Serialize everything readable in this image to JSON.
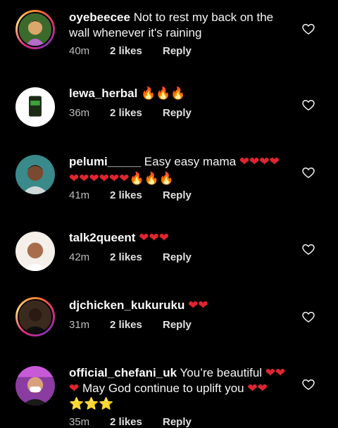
{
  "comments": [
    {
      "username": "oyebeecee",
      "text": "Not to rest my back on the wall whenever it's raining",
      "emoji": "",
      "time": "40m",
      "likes": "2 likes",
      "reply": "Reply"
    },
    {
      "username": "lewa_herbal",
      "text": "",
      "emoji": "🔥🔥🔥",
      "time": "36m",
      "likes": "2 likes",
      "reply": "Reply"
    },
    {
      "username": "pelumi_____",
      "text": "Easy easy mama",
      "emoji": "❤❤❤❤❤❤❤❤❤❤🔥🔥🔥",
      "time": "41m",
      "likes": "2 likes",
      "reply": "Reply"
    },
    {
      "username": "talk2queent",
      "text": "",
      "emoji": "❤❤❤",
      "time": "42m",
      "likes": "2 likes",
      "reply": "Reply"
    },
    {
      "username": "djchicken_kukuruku",
      "text": "",
      "emoji": "❤❤",
      "time": "31m",
      "likes": "2 likes",
      "reply": "Reply"
    },
    {
      "username": "official_chefani_uk",
      "text": "You’re beautiful",
      "emoji_mid": "❤❤❤",
      "text2": "May God continue to uplift you",
      "emoji": "❤❤⭐⭐⭐",
      "time": "35m",
      "likes": "2 likes",
      "reply": "Reply"
    }
  ],
  "icons": {
    "like": "heart-outline-icon"
  },
  "colors": {
    "background": "#000000",
    "heart_red": "#e0252f",
    "story_ring": "#dd2a7b"
  }
}
